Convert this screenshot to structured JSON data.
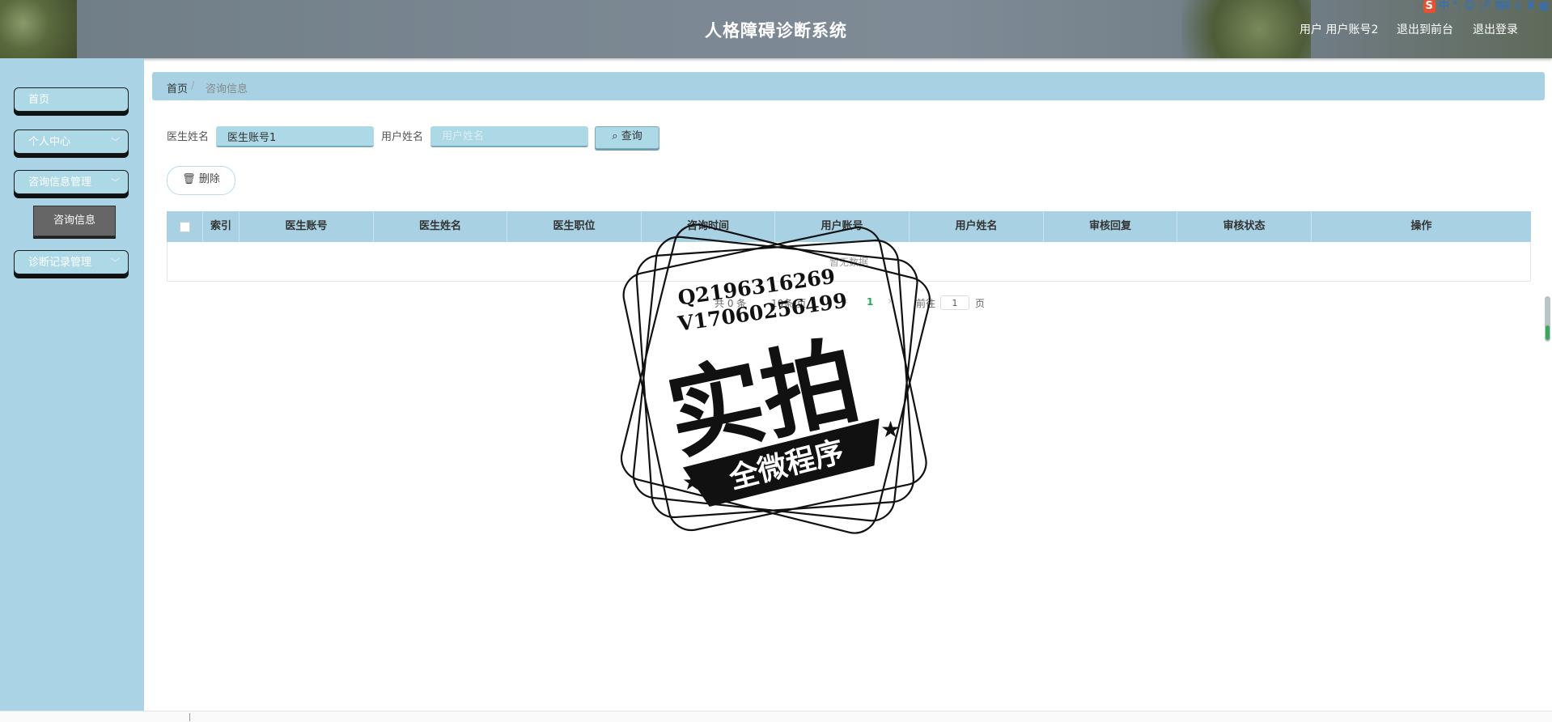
{
  "app": {
    "title": "人格障碍诊断系统"
  },
  "header": {
    "user_label": "用户 用户账号2",
    "back_label": "退出到前台",
    "logout_label": "退出登录"
  },
  "tray": {
    "ime": "中",
    "punct": "°,"
  },
  "sidebar": {
    "items": [
      {
        "label": "首页"
      },
      {
        "label": "个人中心"
      },
      {
        "label": "咨询信息管理"
      },
      {
        "label": "诊断记录管理"
      }
    ],
    "sub_item": "咨询信息"
  },
  "breadcrumb": {
    "home": "首页",
    "separator": "/",
    "current": "咨询信息"
  },
  "search": {
    "doctor_label": "医生姓名",
    "doctor_value": "医生账号1",
    "user_label": "用户姓名",
    "user_placeholder": "用户姓名",
    "button_label": "查询"
  },
  "actions": {
    "delete_label": "删除"
  },
  "table": {
    "headers": [
      "索引",
      "医生账号",
      "医生姓名",
      "医生职位",
      "咨询时间",
      "用户账号",
      "用户姓名",
      "审核回复",
      "审核状态",
      "操作"
    ],
    "empty_text": "暂无数据"
  },
  "pagination": {
    "total_text": "共 0 条",
    "page_size_text": "10条/页",
    "current_page": "1",
    "goto_label": "前往",
    "goto_value": "1",
    "page_suffix": "页"
  },
  "watermark": {
    "line1": "Q2196316269",
    "line2": "V17060256499",
    "main": "实拍",
    "ribbon": "全微程序"
  }
}
